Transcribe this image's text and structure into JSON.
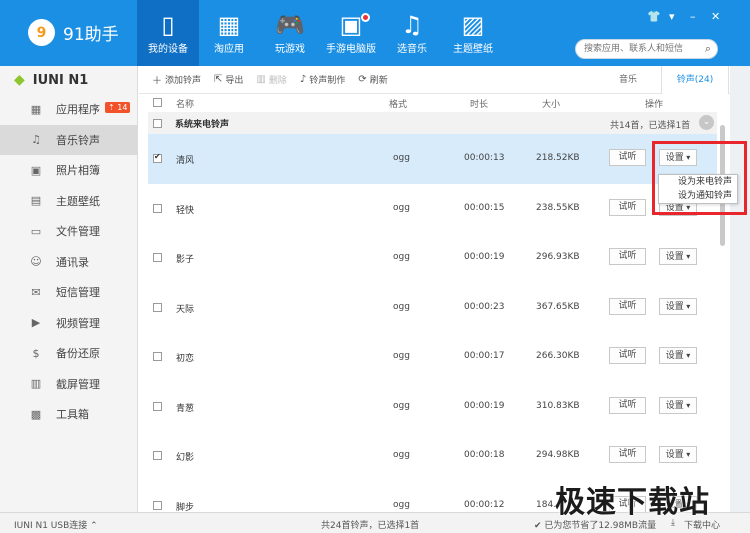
{
  "app": {
    "name": "91助手",
    "search_placeholder": "搜索应用、联系人和短信",
    "window_controls": [
      "👕",
      "▾",
      "–",
      "✕"
    ]
  },
  "nav": [
    {
      "label": "我的设备",
      "icon": "▯",
      "active": true
    },
    {
      "label": "淘应用",
      "icon": "▦",
      "active": false
    },
    {
      "label": "玩游戏",
      "icon": "🎮",
      "active": false
    },
    {
      "label": "手游电脑版",
      "icon": "▣",
      "active": false,
      "dot": true
    },
    {
      "label": "选音乐",
      "icon": "♫",
      "active": false
    },
    {
      "label": "主题壁纸",
      "icon": "▨",
      "active": false
    }
  ],
  "sidebar": {
    "device_name": "IUNI N1",
    "items": [
      {
        "label": "应用程序",
        "icon": "▦",
        "badge": "⇡ 14"
      },
      {
        "label": "音乐铃声",
        "icon": "♫",
        "active": true
      },
      {
        "label": "照片相簿",
        "icon": "▣"
      },
      {
        "label": "主题壁纸",
        "icon": "▤"
      },
      {
        "label": "文件管理",
        "icon": "▭"
      },
      {
        "label": "通讯录",
        "icon": "☺"
      },
      {
        "label": "短信管理",
        "icon": "✉"
      },
      {
        "label": "视频管理",
        "icon": "▶"
      },
      {
        "label": "备份还原",
        "icon": "$"
      },
      {
        "label": "截屏管理",
        "icon": "▥"
      },
      {
        "label": "工具箱",
        "icon": "▩"
      }
    ]
  },
  "toolbar": {
    "add": "添加铃声",
    "export": "导出",
    "delete": "删除",
    "make": "铃声制作",
    "refresh": "刷新",
    "tab_music": "音乐",
    "tab_ringtone": "铃声(24)"
  },
  "table": {
    "headers": {
      "name": "名称",
      "format": "格式",
      "duration": "时长",
      "size": "大小",
      "action": "操作"
    },
    "group_title": "系统来电铃声",
    "group_info": "共14首，已选择1首",
    "group_collapse_icon": "⌄",
    "rows": [
      {
        "name": "清风",
        "format": "ogg",
        "duration": "00:00:13",
        "size": "218.52KB",
        "checked": true
      },
      {
        "name": "轻快",
        "format": "ogg",
        "duration": "00:00:15",
        "size": "238.55KB",
        "checked": false
      },
      {
        "name": "影子",
        "format": "ogg",
        "duration": "00:00:19",
        "size": "296.93KB",
        "checked": false
      },
      {
        "name": "天际",
        "format": "ogg",
        "duration": "00:00:23",
        "size": "367.65KB",
        "checked": false
      },
      {
        "name": "初恋",
        "format": "ogg",
        "duration": "00:00:17",
        "size": "266.30KB",
        "checked": false
      },
      {
        "name": "青葱",
        "format": "ogg",
        "duration": "00:00:19",
        "size": "310.83KB",
        "checked": false
      },
      {
        "name": "幻影",
        "format": "ogg",
        "duration": "00:00:18",
        "size": "294.98KB",
        "checked": false
      },
      {
        "name": "脚步",
        "format": "ogg",
        "duration": "00:00:12",
        "size": "184.4",
        "checked": false
      }
    ],
    "try_label": "试听",
    "set_label": "设置"
  },
  "dropdown": {
    "items": [
      "设为来电铃声",
      "设为通知铃声"
    ]
  },
  "status": {
    "device": "IUNI N1  USB连接 ⌃",
    "summary": "共24首铃声，已选择1首",
    "saved": "✔ 已为您节省了12.98MB流量",
    "download": "下载中心"
  },
  "watermark": "极速下载站"
}
